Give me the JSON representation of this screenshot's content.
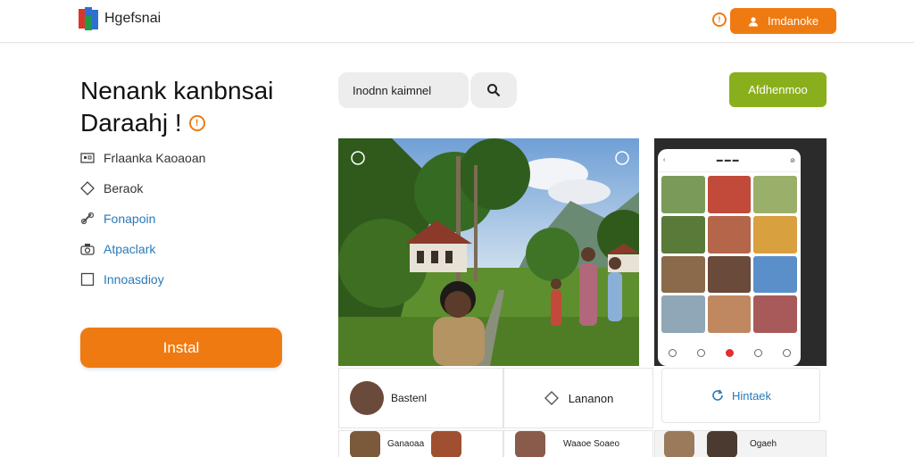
{
  "header": {
    "brand": "Hgefsnai",
    "account_button": "Imdanoke",
    "badge_glyph": "!"
  },
  "hero": {
    "headline_line1": "Nenank kanbnsai",
    "headline_line2": "Daraahj !",
    "info_glyph": "!"
  },
  "features": [
    {
      "label": "Frlaanka Kaoaoan",
      "icon": "gallery-icon",
      "color": "#333333"
    },
    {
      "label": "Beraok",
      "icon": "tag-icon",
      "color": "#333333"
    },
    {
      "label": "Fonapoin",
      "icon": "link-icon",
      "color": "#2a7ab8"
    },
    {
      "label": "Atpaclark",
      "icon": "camera-icon",
      "color": "#2a7ab8"
    },
    {
      "label": "Innoasdioy",
      "icon": "checkbox-icon",
      "color": "#2a7ab8"
    }
  ],
  "install_label": "Instal",
  "search": {
    "value": "Inodnn kaimnel"
  },
  "action_button": "Afdhenmoo",
  "bottom_cards": {
    "card1": "Bastenl",
    "card2": "Lananon",
    "card3": "Hintaek",
    "row2_a": "Ganaoaa",
    "row2_b": "Waaoe Soaeo",
    "row2_c": "Ogaeh"
  },
  "colors": {
    "accent": "#f07a12",
    "green": "#8aaf1d",
    "link": "#2a7ab8"
  }
}
